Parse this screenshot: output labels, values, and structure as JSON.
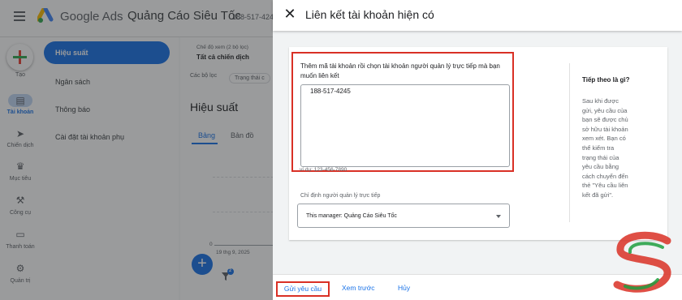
{
  "background": {
    "brand": "Google Ads",
    "account_name": "Quảng Cáo Siêu Tốc",
    "account_id": "188-517-4245",
    "rail": [
      {
        "label": "Tạo",
        "icon": "plus-icon"
      },
      {
        "label": "Tài khoản",
        "icon": "account-icon",
        "active": true
      },
      {
        "label": "Chiến dịch",
        "icon": "megaphone-icon"
      },
      {
        "label": "Mục tiêu",
        "icon": "trophy-icon"
      },
      {
        "label": "Công cụ",
        "icon": "tools-icon"
      },
      {
        "label": "Thanh toán",
        "icon": "card-icon"
      },
      {
        "label": "Quản trị",
        "icon": "gear-icon"
      }
    ],
    "subnav": [
      {
        "label": "Hiệu suất",
        "active": true
      },
      {
        "label": "Ngân sách"
      },
      {
        "label": "Thông báo"
      },
      {
        "label": "Cài đặt tài khoản phụ"
      }
    ],
    "main": {
      "view_label": "Chế độ xem (2 bộ lọc)",
      "view_value": "Tất cả chiến dịch",
      "filters_label": "Các bộ lọc",
      "filter_chip": "Trạng thái c",
      "heading": "Hiệu suất",
      "tab_table": "Bảng",
      "tab_map": "Bản đồ",
      "chart_zero": "0",
      "chart_date": "19 thg 9, 2025",
      "filter_badge": "2"
    }
  },
  "dialog": {
    "title": "Liên kết tài khoản hiện có",
    "instruction": "Thêm mã tài khoản rồi chọn tài khoản người quản lý trực tiếp mà bạn muốn liên kết",
    "account_input_value": "188-517-4245",
    "example_hint": "ví dụ: 123-456-7890",
    "manager_label": "Chỉ định người quản lý trực tiếp",
    "manager_value": "This manager: Quảng Cáo Siêu Tốc",
    "next_title": "Tiếp theo là gì?",
    "next_body": "Sau khi được gửi, yêu cầu của bạn sẽ được chủ sở hữu tài khoản xem xét. Bạn có thể kiểm tra trạng thái của yêu cầu bằng cách chuyển đến thẻ \"Yêu cầu liên kết đã gửi\".",
    "buttons": {
      "send": "Gửi yêu cầu",
      "preview": "Xem trước",
      "cancel": "Hủy"
    }
  },
  "colors": {
    "primary": "#1a73e8",
    "highlight": "#d93025",
    "watermark_red": "#d93025",
    "watermark_green": "#1e9e3e"
  }
}
